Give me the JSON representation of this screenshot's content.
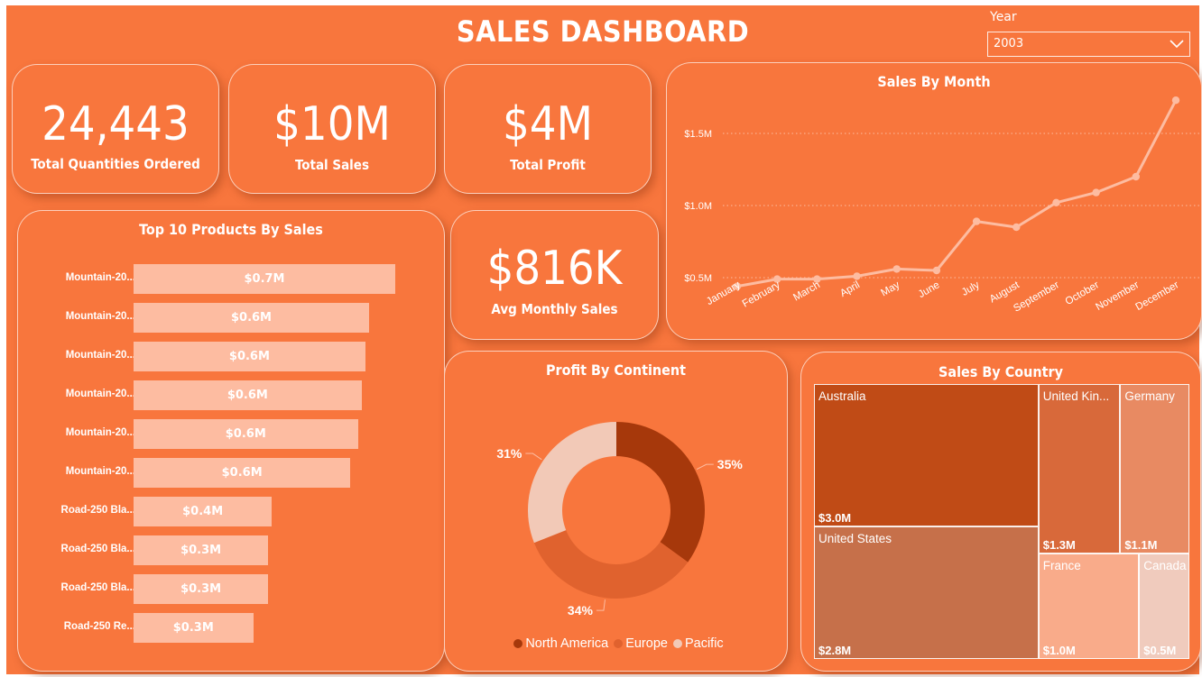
{
  "header": {
    "title": "SALES DASHBOARD"
  },
  "filter": {
    "label": "Year",
    "selected": "2003"
  },
  "kpis": {
    "quantities": {
      "value": "24,443",
      "label": "Total Quantities Ordered"
    },
    "sales": {
      "value": "$10M",
      "label": "Total Sales"
    },
    "profit": {
      "value": "$4M",
      "label": "Total Profit"
    },
    "avg_monthly": {
      "value": "$816K",
      "label": "Avg Monthly Sales"
    }
  },
  "colors": {
    "background": "#f8763d",
    "bar": "#fdbca1",
    "north_america": "#a6380b",
    "europe": "#e0622e",
    "pacific": "#f2c9b7"
  },
  "chart_data": [
    {
      "type": "bar",
      "orientation": "horizontal",
      "title": "Top 10 Products By Sales",
      "categories": [
        "Mountain-20...",
        "Mountain-20...",
        "Mountain-20...",
        "Mountain-20...",
        "Mountain-20...",
        "Mountain-20...",
        "Road-250 Bla...",
        "Road-250 Bla...",
        "Road-250 Bla...",
        "Road-250 Re..."
      ],
      "values": [
        0.7,
        0.63,
        0.62,
        0.61,
        0.6,
        0.58,
        0.37,
        0.36,
        0.36,
        0.32
      ],
      "data_labels": [
        "$0.7M",
        "$0.6M",
        "$0.6M",
        "$0.6M",
        "$0.6M",
        "$0.6M",
        "$0.4M",
        "$0.3M",
        "$0.3M",
        "$0.3M"
      ],
      "unit": "$M",
      "xlim": [
        0,
        0.7
      ]
    },
    {
      "type": "line",
      "title": "Sales By Month",
      "x": [
        "January",
        "February",
        "March",
        "April",
        "May",
        "June",
        "July",
        "August",
        "September",
        "October",
        "November",
        "December"
      ],
      "values": [
        0.44,
        0.49,
        0.49,
        0.51,
        0.56,
        0.55,
        0.89,
        0.85,
        1.02,
        1.09,
        1.2,
        1.73
      ],
      "unit": "$M",
      "ylim": [
        0.35,
        1.8
      ],
      "yticks": [
        0.5,
        1.0,
        1.5
      ],
      "ytick_labels": [
        "$0.5M",
        "$1.0M",
        "$1.5M"
      ],
      "grid": true
    },
    {
      "type": "pie",
      "variant": "donut",
      "title": "Profit By Continent",
      "categories": [
        "North America",
        "Europe",
        "Pacific"
      ],
      "values": [
        35,
        34,
        31
      ],
      "data_labels": [
        "35%",
        "34%",
        "31%"
      ],
      "legend": "bottom"
    },
    {
      "type": "treemap",
      "title": "Sales By Country",
      "categories": [
        "Australia",
        "United States",
        "United Kin...",
        "Germany",
        "France",
        "Canada"
      ],
      "values": [
        3.0,
        2.8,
        1.3,
        1.1,
        1.0,
        0.5
      ],
      "data_labels": [
        "$3.0M",
        "$2.8M",
        "$1.3M",
        "$1.1M",
        "$1.0M",
        "$0.5M"
      ],
      "unit": "$M"
    }
  ]
}
